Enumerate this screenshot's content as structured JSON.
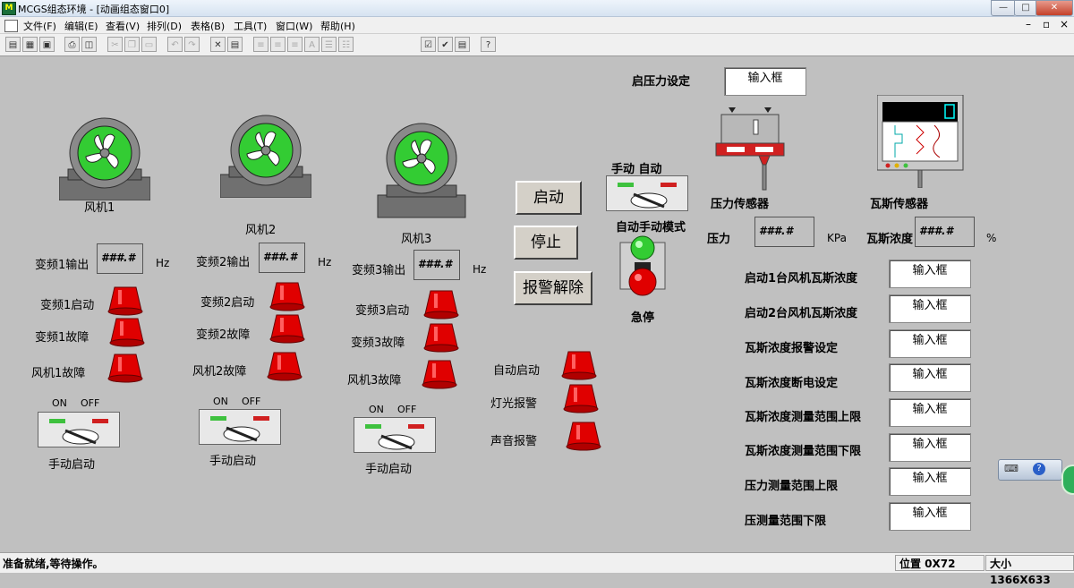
{
  "window": {
    "title": "MCGS组态环境 - [动画组态窗口0]",
    "controls": [
      "—",
      "□",
      "✕"
    ],
    "inner_controls": [
      "–",
      "▫",
      "×"
    ]
  },
  "menu": [
    "文件(F)",
    "编辑(E)",
    "查看(V)",
    "排列(D)",
    "表格(B)",
    "工具(T)",
    "窗口(W)",
    "帮助(H)"
  ],
  "fans": [
    {
      "name": "风机1",
      "freq_label": "变频1输出",
      "value": "###.#",
      "unit": "Hz",
      "start": "变频1启动",
      "fault": "变频1故障",
      "fan_fault": "风机1故障",
      "sw_on": "ON",
      "sw_off": "OFF",
      "manual": "手动启动"
    },
    {
      "name": "风机2",
      "freq_label": "变频2输出",
      "value": "###.#",
      "unit": "Hz",
      "start": "变频2启动",
      "fault": "变频2故障",
      "fan_fault": "风机2故障",
      "sw_on": "ON",
      "sw_off": "OFF",
      "manual": "手动启动"
    },
    {
      "name": "风机3",
      "freq_label": "变频3输出",
      "value": "###.#",
      "unit": "Hz",
      "start": "变频3启动",
      "fault": "变频3故障",
      "fan_fault": "风机3故障",
      "sw_on": "ON",
      "sw_off": "OFF",
      "manual": "手动启动"
    }
  ],
  "buttons": {
    "start": "启动",
    "stop": "停止",
    "reset_alarm": "报警解除"
  },
  "mode": {
    "label": "手动 自动",
    "title": "自动手动模式",
    "estop": "急停"
  },
  "indicators": {
    "auto_start": "自动启动",
    "light_alarm": "灯光报警",
    "sound_alarm": "声音报警"
  },
  "pressure_setting": {
    "label": "启压力设定",
    "input": "输入框"
  },
  "sensors": {
    "pressure": "压力传感器",
    "gas": "瓦斯传感器"
  },
  "readouts": {
    "pressure_label": "压力",
    "pressure_value": "###.#",
    "pressure_unit": "KPa",
    "gas_label": "瓦斯浓度",
    "gas_value": "###.#",
    "gas_unit": "%"
  },
  "settings": [
    {
      "label": "启动1台风机瓦斯浓度",
      "input": "输入框"
    },
    {
      "label": "启动2台风机瓦斯浓度",
      "input": "输入框"
    },
    {
      "label": "瓦斯浓度报警设定",
      "input": "输入框"
    },
    {
      "label": "瓦斯浓度断电设定",
      "input": "输入框"
    },
    {
      "label": "瓦斯浓度测量范围上限",
      "input": "输入框"
    },
    {
      "label": "瓦斯浓度测量范围下限",
      "input": "输入框"
    },
    {
      "label": "压力测量范围上限",
      "input": "输入框"
    },
    {
      "label": "压测量范围下限",
      "input": "输入框"
    }
  ],
  "status": {
    "message": "准备就绪,等待操作。",
    "position": "位置 0X72",
    "size": "大小 1366X633"
  },
  "colors": {
    "lamp_red": "#e00000",
    "fan_green": "#33cc33",
    "on_green": "#3ec13e",
    "off_red": "#d02020"
  }
}
